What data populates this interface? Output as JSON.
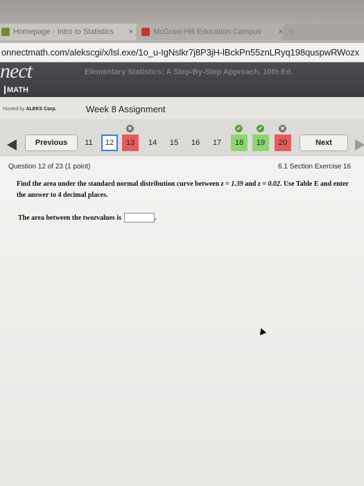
{
  "browser": {
    "tabs": [
      {
        "label": "Homepage - Intro to Statistics",
        "close": "×"
      },
      {
        "label": "McGraw-Hill Education Campus",
        "close": "×"
      },
      {
        "label": "M"
      }
    ],
    "url": "onnectmath.com/alekscgi/x/lsl.exe/1o_u-IgNslkr7j8P3jH-lBckPn55znLRyq198quspwRWozx"
  },
  "header": {
    "logo": "nect",
    "product": "MATH",
    "book_title": "Elementary Statistics: A Step-By-Step Approach, 10th Ed.",
    "hosted_prefix": "Hosted by ",
    "hosted_brand": "ALEKS Corp.",
    "assignment": "Week 8 Assignment"
  },
  "nav": {
    "previous": "Previous",
    "next": "Next",
    "questions": [
      "11",
      "12",
      "13",
      "14",
      "15",
      "16",
      "17",
      "18",
      "19",
      "20"
    ]
  },
  "question": {
    "header": "Question 12 of 23 (1 point)",
    "section": "6.1 Section Exercise 16",
    "text_1": "Find the area under the standard normal distribution curve between ",
    "z1": "z = 1.39",
    "and": " and ",
    "z2": "z = 0.02",
    "text_2": ". Use Table E and enter the answer to 4 decimal places.",
    "answer_label": "The area between the two ",
    "answer_z": "z",
    "answer_label_2": " values is ",
    "answer_value": "",
    "period": "."
  }
}
